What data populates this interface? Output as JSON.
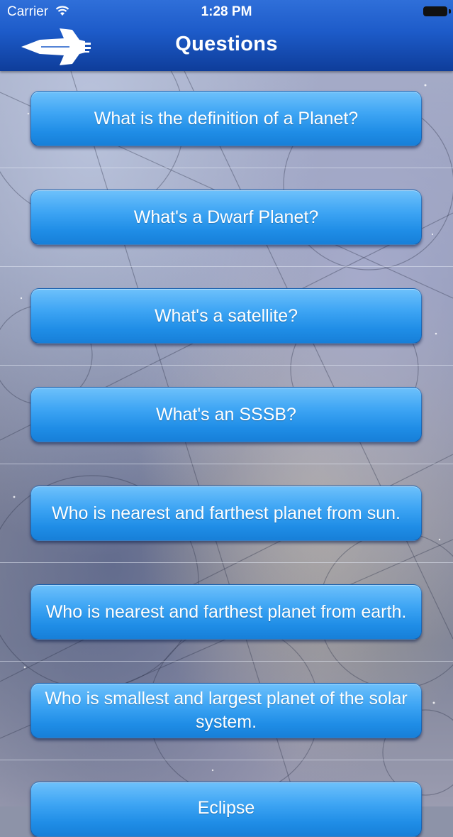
{
  "status_bar": {
    "carrier": "Carrier",
    "time": "1:28 PM"
  },
  "nav": {
    "title": "Questions",
    "back_icon": "spaceship-icon"
  },
  "colors": {
    "nav": "#1d5bc9",
    "button": "#3ea5f4"
  },
  "questions": [
    "What is the definition of a Planet?",
    "What's a Dwarf Planet?",
    "What's a satellite?",
    "What's an SSSB?",
    "Who is nearest and farthest  planet from sun.",
    "Who is nearest and farthest  planet from earth.",
    "Who is smallest and largest planet of the solar system.",
    "Eclipse"
  ]
}
